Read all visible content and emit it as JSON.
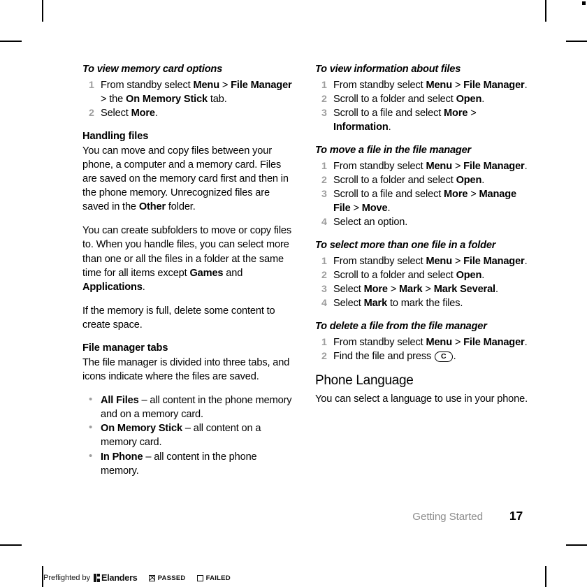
{
  "page": {
    "footer_section": "Getting Started",
    "page_number": "17"
  },
  "left_column": {
    "proc1": {
      "title": "To view memory card options",
      "steps": [
        "From standby select <b>Menu</b> <span class=\"gt\">&gt;</span> <b>File Manager</b> <span class=\"gt\">&gt;</span> the <b>On Memory Stick</b> tab.",
        "Select <b>More</b>."
      ]
    },
    "handling": {
      "heading": "Handling files",
      "para1": "You can move and copy files between your phone, a computer and a memory card. Files are saved on the memory card first and then in the phone memory. Unrecognized files are saved in the <b>Other</b> folder.",
      "para2": "You can create subfolders to move or copy files to. When you handle files, you can select more than one or all the files in a folder at the same time for all items except <b>Games</b> and <b>Applications</b>.",
      "para3": "If the memory is full, delete some content to create space."
    },
    "tabs": {
      "heading": "File manager tabs",
      "intro": "The file manager is divided into three tabs, and icons indicate where the files are saved.",
      "bullets": [
        "<b>All Files</b> &#8211; all content in the phone memory and on a memory card.",
        "<b>On Memory Stick</b> &#8211; all content on a memory card.",
        "<b>In Phone</b> &#8211; all content in the phone memory."
      ]
    }
  },
  "right_column": {
    "proc_info": {
      "title": "To view information about files",
      "steps": [
        "From standby select <b>Menu</b> <span class=\"gt\">&gt;</span> <b>File Manager</b>.",
        "Scroll to a folder and select <b>Open</b>.",
        "Scroll to a file and select <b>More</b> <span class=\"gt\">&gt;</span> <b>Information</b>."
      ]
    },
    "proc_move": {
      "title": "To move a file in the file manager",
      "steps": [
        "From standby select <b>Menu</b> <span class=\"gt\">&gt;</span> <b>File Manager</b>.",
        "Scroll to a folder and select <b>Open</b>.",
        "Scroll to a file and select <b>More</b> <span class=\"gt\">&gt;</span> <b>Manage File</b> <span class=\"gt\">&gt;</span> <b>Move</b>.",
        "Select an option."
      ]
    },
    "proc_select": {
      "title": "To select more than one file in a folder",
      "steps": [
        "From standby select <b>Menu</b> <span class=\"gt\">&gt;</span> <b>File Manager</b>.",
        "Scroll to a folder and select <b>Open</b>.",
        "Select <b>More</b> <span class=\"gt\">&gt;</span> <b>Mark</b> <span class=\"gt\">&gt;</span> <b>Mark Several</b>.",
        "Select <b>Mark</b> to mark the files."
      ]
    },
    "proc_delete": {
      "title": "To delete a file from the file manager",
      "steps": [
        "From standby select <b>Menu</b> <span class=\"gt\">&gt;</span> <b>File Manager</b>.",
        "Find the file and press <span class=\"keycap\">C</span>."
      ]
    },
    "language": {
      "heading": "Phone Language",
      "para": "You can select a language to use in your phone."
    }
  },
  "preflight": {
    "prefix": "Preflighted by",
    "brand": "Elanders",
    "passed_label": "PASSED",
    "failed_label": "FAILED"
  },
  "colors": {
    "step_number": "#9d9d9d",
    "bullet": "#9d9d9d",
    "footer_section": "#8d8d8d",
    "text": "#000000"
  }
}
